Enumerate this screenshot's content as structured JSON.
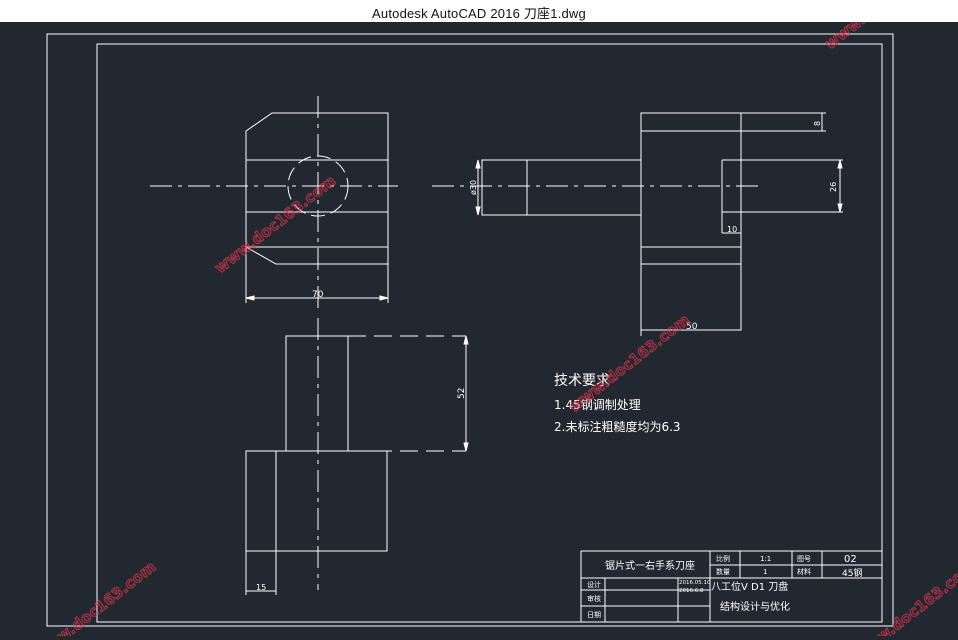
{
  "window": {
    "title": "Autodesk AutoCAD 2016    刀座1.dwg"
  },
  "colors": {
    "background": "#212830",
    "lines": "#ffffff",
    "watermark": "#e8384f"
  },
  "watermark": "www.doc163.com",
  "dimensions": {
    "width_70": "70",
    "width_50": "50",
    "dia_30": "ø30",
    "size_8": "8",
    "size_26": "26",
    "size_10": "10",
    "height_52": "52",
    "size_15": "15"
  },
  "notes": {
    "title": "技术要求",
    "line1": "1.45钢调制处理",
    "line2": "2.未标注粗糙度均为6.3"
  },
  "title_block": {
    "part_name": "锯片式一右手系刀座",
    "scale_label": "比例",
    "scale_value": "1:1",
    "drawing_no_label": "图号",
    "drawing_no": "02",
    "quantity_label": "数量",
    "quantity_value": "1",
    "material_label": "材料",
    "material_value": "45钢",
    "designer_label": "设计",
    "checker_label": "审核",
    "approver_label": "日期",
    "date1": "2016.05.10",
    "date2": "2016.6.8",
    "project_line1": "八工位V D1 刀盘",
    "project_line2": "结构设计与优化"
  }
}
